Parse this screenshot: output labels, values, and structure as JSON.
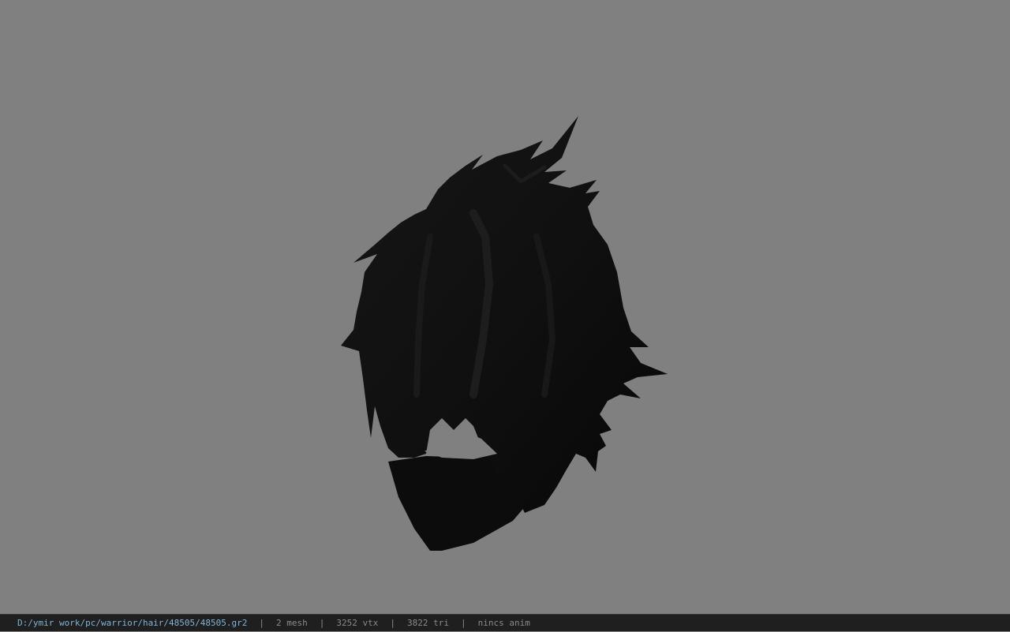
{
  "viewer": {
    "background_color": "#808080",
    "model_color": "#0f0f0f",
    "model_icon": "hair-mesh-model"
  },
  "status_bar": {
    "file_path": "D:/ymir work/pc/warrior/hair/48505/48505.gr2",
    "separator": "|",
    "mesh_count": "2 mesh",
    "vertex_count": "3252 vtx",
    "triangle_count": "3822 tri",
    "anim_status": "nincs anim",
    "path_color": "#7fb4d8"
  }
}
